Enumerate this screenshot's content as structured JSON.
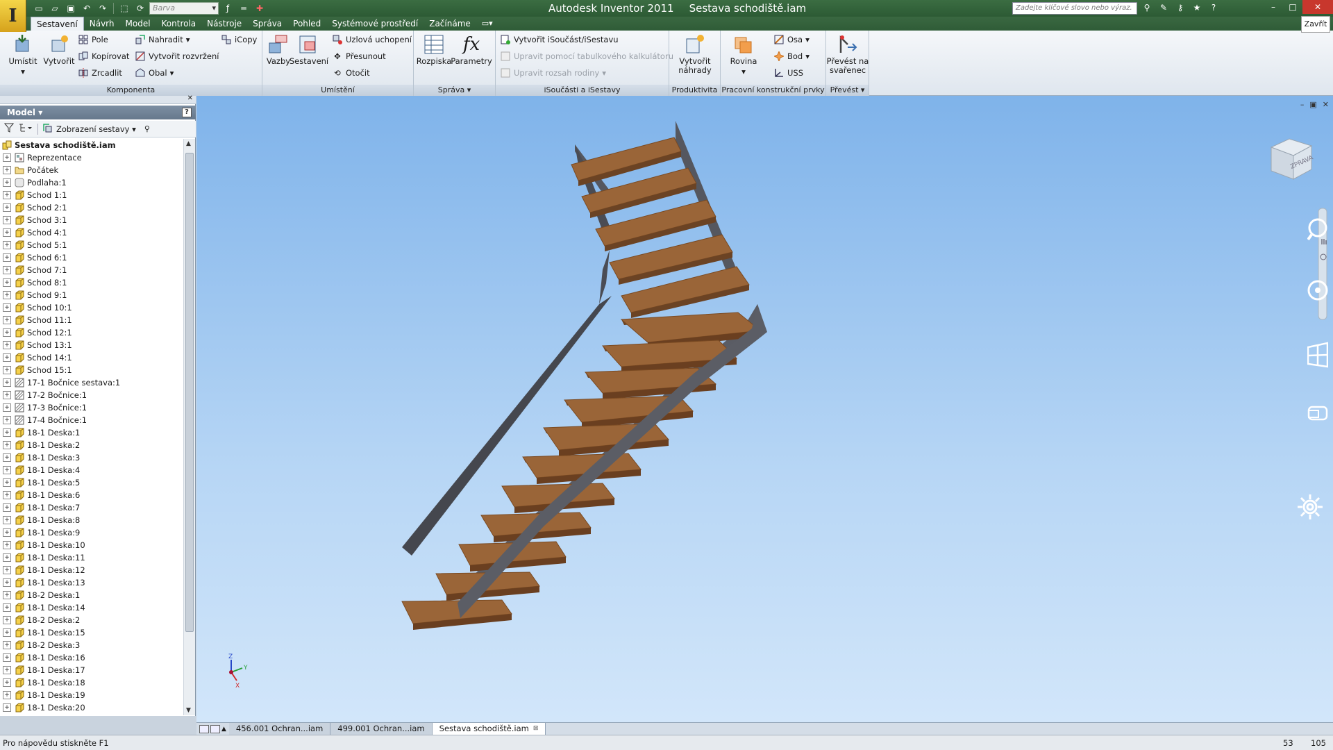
{
  "window": {
    "app_name": "Autodesk Inventor 2011",
    "document": "Sestava schodiště.iam",
    "logo_letter": "I"
  },
  "quick_access": {
    "style_select": "Barva",
    "icons": [
      "new-file-icon",
      "open-icon",
      "save-icon",
      "undo-icon",
      "redo-icon",
      "select-icon",
      "parameters-icon",
      "line-weight-icon",
      "cross-icon"
    ]
  },
  "help_search": {
    "placeholder": "Zadejte klíčové slovo nebo výraz."
  },
  "close_tooltip": "Zavřít",
  "ribbon_tabs": [
    {
      "label": "Sestavení",
      "active": true
    },
    {
      "label": "Návrh"
    },
    {
      "label": "Model"
    },
    {
      "label": "Kontrola"
    },
    {
      "label": "Nástroje"
    },
    {
      "label": "Správa"
    },
    {
      "label": "Pohled"
    },
    {
      "label": "Systémové prostředí"
    },
    {
      "label": "Začínáme"
    }
  ],
  "ribbon": {
    "komponenta": {
      "title": "Komponenta",
      "umistit": "Umístit",
      "vytvorit": "Vytvořit",
      "pole": "Pole",
      "kopirovat": "Kopírovat",
      "zrcadlit": "Zrcadlit",
      "nahradit": "Nahradit",
      "vytvorit_rozvrzeni": "Vytvořit rozvržení",
      "obal": "Obal",
      "icopy": "iCopy"
    },
    "umisteni": {
      "title": "Umístění",
      "vazby": "Vazby",
      "sestaveni": "Sestavení",
      "uzlova": "Uzlová uchopení",
      "presunout": "Přesunout",
      "otocit": "Otočit"
    },
    "sprava": {
      "title": "Správa",
      "rozpiska": "Rozpiska",
      "parametry": "Parametry"
    },
    "isoucasti": {
      "title": "iSoučásti a iSestavy",
      "vytvorit": "Vytvořit iSoučást/iSestavu",
      "upravit_tab": "Upravit pomocí tabulkového kalkulátoru",
      "upravit_rozsah": "Upravit rozsah rodiny"
    },
    "produktivita": {
      "title": "Produktivita",
      "vytvorit_nahrady_1": "Vytvořit",
      "vytvorit_nahrady_2": "náhrady"
    },
    "pracovni": {
      "title": "Pracovní konstrukční prvky",
      "rovina": "Rovina",
      "osa": "Osa",
      "bod": "Bod",
      "uss": "USS"
    },
    "prevest": {
      "title": "Převést",
      "prevest_1": "Převést na",
      "prevest_2": "svařenec"
    }
  },
  "browser": {
    "title": "Model",
    "view_label": "Zobrazení sestavy",
    "help": "?",
    "items": [
      {
        "label": "Sestava schodiště.iam",
        "icon": "assembly",
        "root": true
      },
      {
        "label": "Reprezentace",
        "icon": "representation"
      },
      {
        "label": "Počátek",
        "icon": "folder"
      },
      {
        "label": "Podlaha:1",
        "icon": "floor-part"
      },
      {
        "label": "Schod 1:1",
        "icon": "part"
      },
      {
        "label": "Schod 2:1",
        "icon": "part"
      },
      {
        "label": "Schod 3:1",
        "icon": "part"
      },
      {
        "label": "Schod 4:1",
        "icon": "part"
      },
      {
        "label": "Schod 5:1",
        "icon": "part"
      },
      {
        "label": "Schod 6:1",
        "icon": "part"
      },
      {
        "label": "Schod 7:1",
        "icon": "part"
      },
      {
        "label": "Schod 8:1",
        "icon": "part"
      },
      {
        "label": "Schod 9:1",
        "icon": "part"
      },
      {
        "label": "Schod 10:1",
        "icon": "part"
      },
      {
        "label": "Schod 11:1",
        "icon": "part"
      },
      {
        "label": "Schod 12:1",
        "icon": "part"
      },
      {
        "label": "Schod 13:1",
        "icon": "part"
      },
      {
        "label": "Schod 14:1",
        "icon": "part"
      },
      {
        "label": "Schod 15:1",
        "icon": "part"
      },
      {
        "label": "17-1 Bočnice sestava:1",
        "icon": "assembly-part"
      },
      {
        "label": "17-2 Bočnice:1",
        "icon": "assembly-part"
      },
      {
        "label": "17-3 Bočnice:1",
        "icon": "assembly-part"
      },
      {
        "label": "17-4 Bočnice:1",
        "icon": "assembly-part"
      },
      {
        "label": "18-1 Deska:1",
        "icon": "part"
      },
      {
        "label": "18-1 Deska:2",
        "icon": "part"
      },
      {
        "label": "18-1 Deska:3",
        "icon": "part"
      },
      {
        "label": "18-1 Deska:4",
        "icon": "part"
      },
      {
        "label": "18-1 Deska:5",
        "icon": "part"
      },
      {
        "label": "18-1 Deska:6",
        "icon": "part"
      },
      {
        "label": "18-1 Deska:7",
        "icon": "part"
      },
      {
        "label": "18-1 Deska:8",
        "icon": "part"
      },
      {
        "label": "18-1 Deska:9",
        "icon": "part"
      },
      {
        "label": "18-1 Deska:10",
        "icon": "part"
      },
      {
        "label": "18-1 Deska:11",
        "icon": "part"
      },
      {
        "label": "18-1 Deska:12",
        "icon": "part"
      },
      {
        "label": "18-1 Deska:13",
        "icon": "part"
      },
      {
        "label": "18-2 Deska:1",
        "icon": "part"
      },
      {
        "label": "18-1 Deska:14",
        "icon": "part"
      },
      {
        "label": "18-2 Deska:2",
        "icon": "part"
      },
      {
        "label": "18-1 Deska:15",
        "icon": "part"
      },
      {
        "label": "18-2 Deska:3",
        "icon": "part"
      },
      {
        "label": "18-1 Deska:16",
        "icon": "part"
      },
      {
        "label": "18-1 Deska:17",
        "icon": "part"
      },
      {
        "label": "18-1 Deska:18",
        "icon": "part"
      },
      {
        "label": "18-1 Deska:19",
        "icon": "part"
      },
      {
        "label": "18-1 Deska:20",
        "icon": "part"
      }
    ]
  },
  "viewcube": {
    "face_label": "ZPRAVA"
  },
  "triad": {
    "x": "X",
    "y": "Y",
    "z": "Z"
  },
  "document_tabs": [
    {
      "label": "456.001 Ochran...iam"
    },
    {
      "label": "499.001 Ochran...iam"
    },
    {
      "label": "Sestava schodiště.iam",
      "active": true
    }
  ],
  "status": {
    "help_text": "Pro nápovědu stiskněte F1",
    "value1": "53",
    "value2": "105"
  },
  "colors": {
    "title_green": "#2f5c37",
    "viewport_top": "#7fb3ea",
    "wood": "#9a6538",
    "steel": "#4d4f57"
  }
}
